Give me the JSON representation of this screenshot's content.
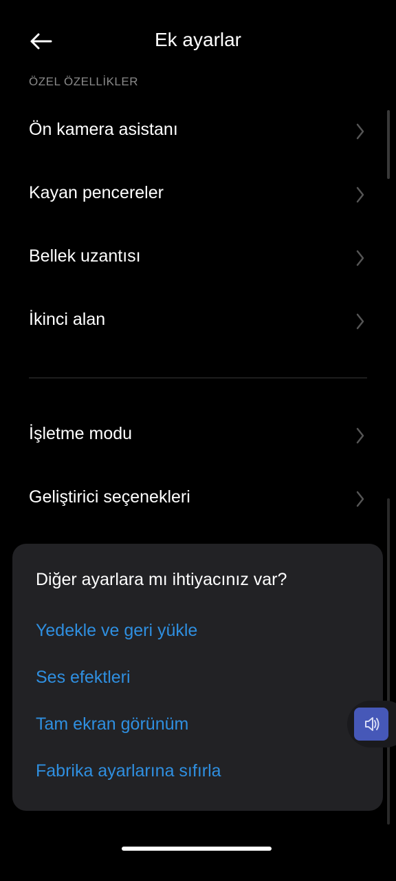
{
  "header": {
    "title": "Ek ayarlar",
    "back_icon": "arrow-left-icon"
  },
  "section_label": "ÖZEL ÖZELLİKLER",
  "items_group1": [
    {
      "label": "Ön kamera asistanı"
    },
    {
      "label": "Kayan pencereler"
    },
    {
      "label": "Bellek uzantısı"
    },
    {
      "label": "İkinci alan"
    }
  ],
  "items_group2": [
    {
      "label": "İşletme modu"
    },
    {
      "label": "Geliştirici seçenekleri"
    }
  ],
  "card": {
    "question": "Diğer ayarlara mı ihtiyacınız var?",
    "links": [
      {
        "label": "Yedekle ve geri yükle"
      },
      {
        "label": "Ses efektleri"
      },
      {
        "label": "Tam ekran görünüm"
      },
      {
        "label": "Fabrika ayarlarına sıfırla"
      }
    ]
  },
  "floating_button": {
    "icon": "volume-icon"
  },
  "colors": {
    "background": "#000000",
    "link": "#2f8fe0",
    "card": "#222225",
    "accent_button": "#4658b8"
  }
}
